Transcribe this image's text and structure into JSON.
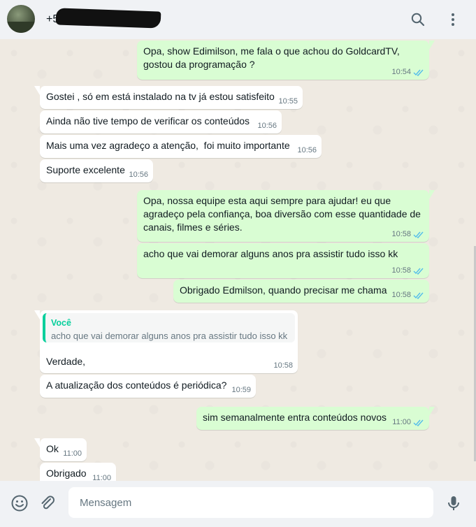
{
  "header": {
    "contact_name": "+55",
    "search_icon": "search-icon",
    "menu_icon": "kebab-menu-icon"
  },
  "messages": [
    {
      "dir": "out",
      "lines": [
        "Opa, show Edimilson, me fala o que achou do GoldcardTV,",
        "gostou da programação ?"
      ],
      "time": "10:54",
      "read": true
    },
    {
      "dir": "in",
      "text": "Gostei , só em está instalado na tv já estou satisfeito",
      "time": "10:55"
    },
    {
      "dir": "in",
      "text": "Ainda não tive tempo de verificar os conteúdos",
      "time": "10:56"
    },
    {
      "dir": "in",
      "text": "Mais uma vez agradeço a atenção,  foi muito importante",
      "time": "10:56"
    },
    {
      "dir": "in",
      "text": "Suporte excelente",
      "time": "10:56"
    },
    {
      "dir": "out",
      "lines": [
        "Opa, nossa equipe esta aqui sempre para ajudar! eu que",
        "agradeço pela confiança, boa diversão com esse quantidade de",
        "canais, filmes e séries."
      ],
      "time": "10:58",
      "read": true
    },
    {
      "dir": "out",
      "text": "acho que vai demorar alguns anos pra assistir tudo isso kk",
      "time": "10:58",
      "read": true
    },
    {
      "dir": "out",
      "text": "Obrigado Edmilson, quando precisar me chama",
      "time": "10:58",
      "read": true
    },
    {
      "dir": "in",
      "quote": {
        "author": "Você",
        "text": "acho que vai demorar alguns anos pra assistir tudo isso kk"
      },
      "text": "Verdade,",
      "time": "10:58"
    },
    {
      "dir": "in",
      "text": "A atualização dos conteúdos é periódica?",
      "time": "10:59"
    },
    {
      "dir": "out",
      "text": "sim semanalmente entra conteúdos novos",
      "time": "11:00",
      "read": true
    },
    {
      "dir": "in",
      "text": "Ok",
      "time": "11:00"
    },
    {
      "dir": "in",
      "text": "Obrigado",
      "time": "11:00"
    }
  ],
  "footer": {
    "placeholder": "Mensagem",
    "emoji_icon": "emoji-icon",
    "attach_icon": "paperclip-icon",
    "mic_icon": "microphone-icon"
  },
  "colors": {
    "outgoing_bubble": "#d9fdd3",
    "incoming_bubble": "#ffffff",
    "read_ticks": "#53bdeb",
    "quote_accent": "#06cf9c"
  }
}
